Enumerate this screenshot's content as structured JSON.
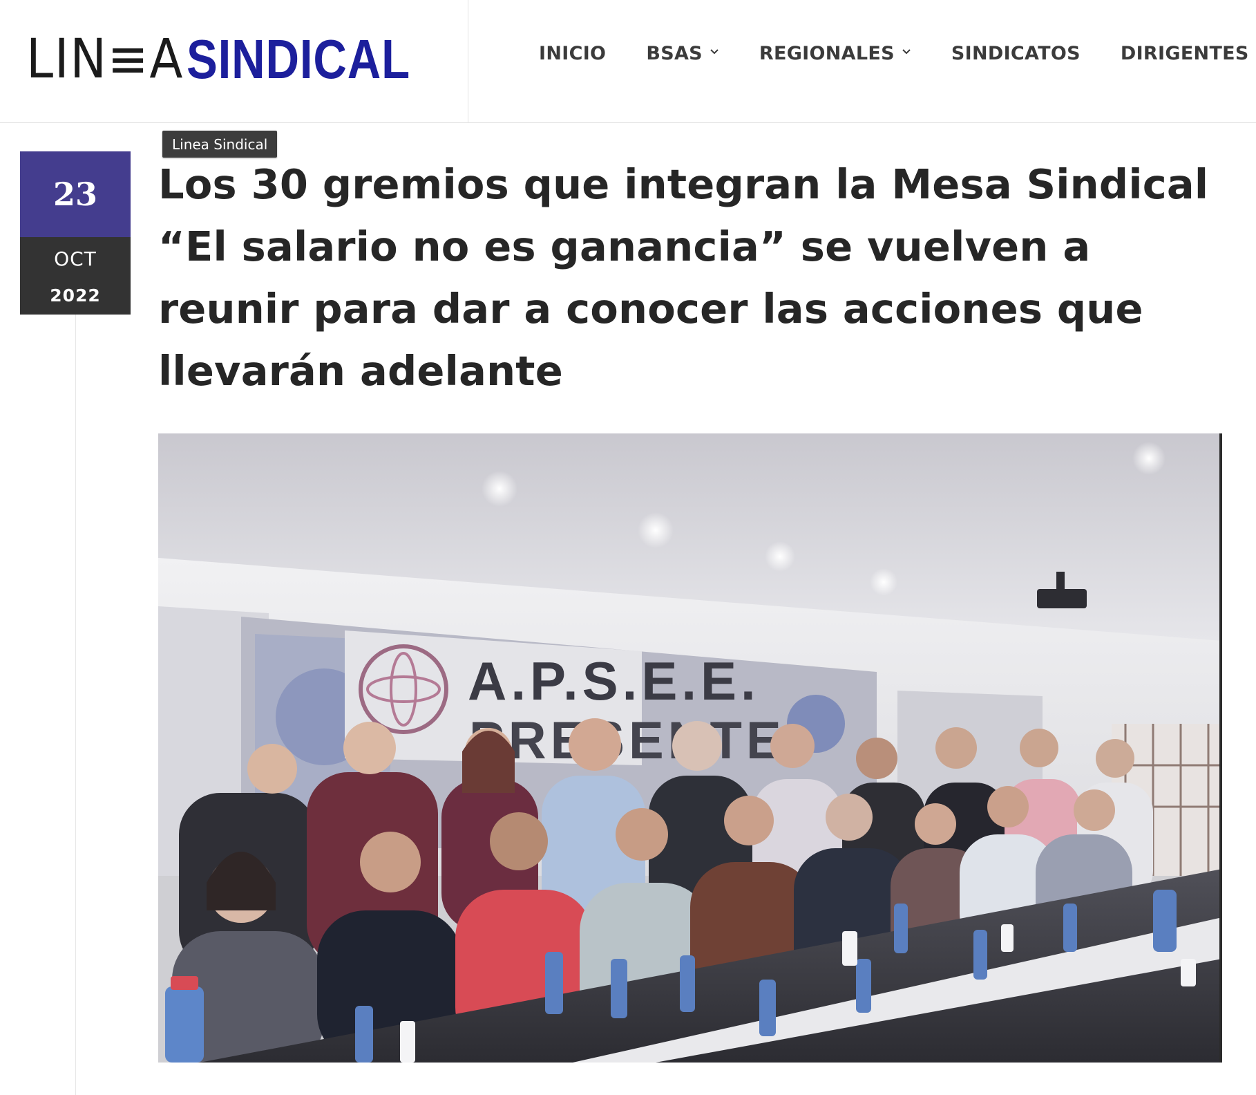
{
  "header": {
    "logo": {
      "light_text": "LIN≡A",
      "bold_text": "SINDICAL"
    },
    "nav": [
      {
        "label": "INICIO",
        "has_dropdown": false
      },
      {
        "label": "BSAS",
        "has_dropdown": true
      },
      {
        "label": "REGIONALES",
        "has_dropdown": true
      },
      {
        "label": "SINDICATOS",
        "has_dropdown": false
      },
      {
        "label": "DIRIGENTES",
        "has_dropdown": false
      }
    ]
  },
  "article": {
    "date": {
      "day": "23",
      "month": "OCT",
      "year": "2022"
    },
    "category": "Linea Sindical",
    "title": "Los 30 gremios que integran la Mesa Sindical “El salario no es ganancia” se vuelven a reunir para dar a conocer las acciones que llevarán adelante",
    "image": {
      "banner_line1": "A.P.S.E.E.",
      "banner_line2": "PRESENTE"
    }
  },
  "colors": {
    "brand_blue": "#1c1f9c",
    "date_purple": "#443d8e",
    "date_dark": "#333333",
    "title_text": "#262626"
  }
}
